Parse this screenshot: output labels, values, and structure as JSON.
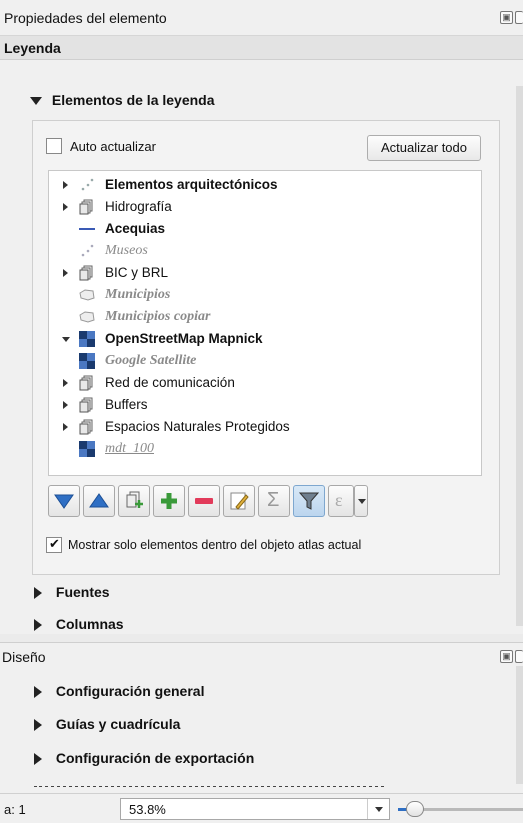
{
  "panel": {
    "title": "Propiedades del elemento",
    "section": "Leyenda"
  },
  "legend_items_group": {
    "title": "Elementos de la leyenda",
    "auto_update_label": "Auto actualizar",
    "auto_update_checked": false,
    "update_all_label": "Actualizar todo",
    "tree": [
      {
        "label": "Elementos arquitectónicos",
        "icon": "point-layer-icon",
        "expandable": true,
        "expanded": false,
        "bold": true,
        "italic": false
      },
      {
        "label": "Hidrografía",
        "icon": "layer-group-icon",
        "expandable": true,
        "expanded": false,
        "bold": false,
        "italic": false
      },
      {
        "label": "Acequias",
        "icon": "line-layer-icon",
        "expandable": false,
        "bold": true,
        "italic": false
      },
      {
        "label": "Museos",
        "icon": "point-layer-icon",
        "expandable": false,
        "bold": false,
        "italic": true
      },
      {
        "label": "BIC y BRL",
        "icon": "layer-group-icon",
        "expandable": true,
        "expanded": false,
        "bold": false,
        "italic": false
      },
      {
        "label": "Municipios",
        "icon": "polygon-layer-icon",
        "expandable": false,
        "bold": true,
        "italic": true
      },
      {
        "label": "Municipios copiar",
        "icon": "polygon-layer-icon",
        "expandable": false,
        "bold": true,
        "italic": true
      },
      {
        "label": "OpenStreetMap Mapnick",
        "icon": "raster-layer-icon",
        "expandable": true,
        "expanded": true,
        "bold": true,
        "italic": false
      },
      {
        "label": "Google Satellite",
        "icon": "raster-layer-icon",
        "expandable": false,
        "bold": true,
        "italic": true
      },
      {
        "label": "Red de comunicación",
        "icon": "layer-group-icon",
        "expandable": true,
        "expanded": false,
        "bold": false,
        "italic": false
      },
      {
        "label": "Buffers",
        "icon": "layer-group-icon",
        "expandable": true,
        "expanded": false,
        "bold": false,
        "italic": false
      },
      {
        "label": "Espacios Naturales Protegidos",
        "icon": "layer-group-icon",
        "expandable": true,
        "expanded": false,
        "bold": false,
        "italic": false
      },
      {
        "label": "mdt_100",
        "icon": "raster-layer-icon",
        "expandable": false,
        "bold": false,
        "italic": true,
        "underline": true
      }
    ],
    "toolbar": [
      {
        "name": "move-down-icon"
      },
      {
        "name": "move-up-icon"
      },
      {
        "name": "add-group-icon"
      },
      {
        "name": "add-item-icon"
      },
      {
        "name": "remove-item-icon"
      },
      {
        "name": "edit-item-icon"
      },
      {
        "name": "sum-icon",
        "symbol": "Σ"
      },
      {
        "name": "filter-icon"
      },
      {
        "name": "expression-icon",
        "symbol": "ε"
      }
    ],
    "atlas_only_label": "Mostrar solo elementos dentro del objeto atlas actual",
    "atlas_only_checked": true
  },
  "collapsed_groups": [
    "Fuentes",
    "Columnas"
  ],
  "layout_panel": {
    "title": "Diseño",
    "groups": [
      "Configuración general",
      "Guías y cuadrícula",
      "Configuración de exportación"
    ]
  },
  "status": {
    "scale_label": "a: 1",
    "zoom_value": "53.8%"
  }
}
